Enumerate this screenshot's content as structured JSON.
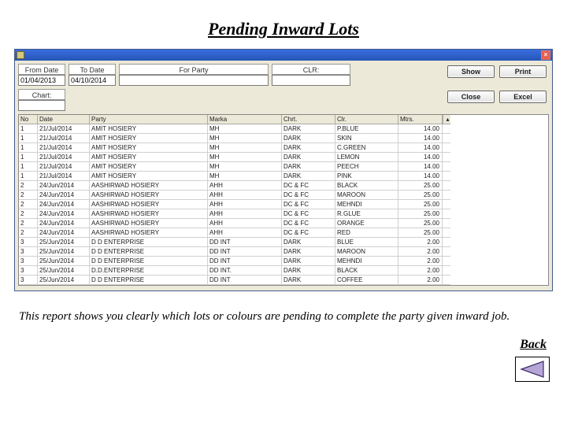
{
  "page": {
    "title": "Pending Inward Lots",
    "caption": "This report shows you clearly which lots or colours are pending to complete the party given inward job.",
    "back": "Back"
  },
  "filters": {
    "from_date_label": "From Date",
    "from_date_value": "01/04/2013",
    "to_date_label": "To Date",
    "to_date_value": "04/10/2014",
    "for_party_label": "For Party",
    "for_party_value": "",
    "clr_label": "CLR:",
    "clr_value": "",
    "chart_label": "Chart:",
    "chart_value": ""
  },
  "buttons": {
    "show": "Show",
    "print": "Print",
    "close": "Close",
    "excel": "Excel"
  },
  "grid": {
    "headers": [
      "No",
      "Date",
      "Party",
      "Marka",
      "Chrt.",
      "Clr.",
      "Mtrs."
    ],
    "rows": [
      {
        "no": "1",
        "date": "21/Jul/2014",
        "party": "AMIT HOSIERY",
        "marka": "MH",
        "chrt": "DARK",
        "clr": "P.BLUE",
        "mtrs": "14.00"
      },
      {
        "no": "1",
        "date": "21/Jul/2014",
        "party": "AMIT HOSIERY",
        "marka": "MH",
        "chrt": "DARK",
        "clr": "SKIN",
        "mtrs": "14.00"
      },
      {
        "no": "1",
        "date": "21/Jul/2014",
        "party": "AMIT HOSIERY",
        "marka": "MH",
        "chrt": "DARK",
        "clr": "C.GREEN",
        "mtrs": "14.00"
      },
      {
        "no": "1",
        "date": "21/Jul/2014",
        "party": "AMIT HOSIERY",
        "marka": "MH",
        "chrt": "DARK",
        "clr": "LEMON",
        "mtrs": "14.00"
      },
      {
        "no": "1",
        "date": "21/Jul/2014",
        "party": "AMIT HOSIERY",
        "marka": "MH",
        "chrt": "DARK",
        "clr": "PEECH",
        "mtrs": "14.00"
      },
      {
        "no": "1",
        "date": "21/Jul/2014",
        "party": "AMIT HOSIERY",
        "marka": "MH",
        "chrt": "DARK",
        "clr": "PINK",
        "mtrs": "14.00"
      },
      {
        "no": "2",
        "date": "24/Jun/2014",
        "party": "AASHIRWAD HOSIERY",
        "marka": "AHH",
        "chrt": "DC & FC",
        "clr": "BLACK",
        "mtrs": "25.00"
      },
      {
        "no": "2",
        "date": "24/Jun/2014",
        "party": "AASHIRWAD HOSIERY",
        "marka": "AHH",
        "chrt": "DC & FC",
        "clr": "MAROON",
        "mtrs": "25.00"
      },
      {
        "no": "2",
        "date": "24/Jun/2014",
        "party": "AASHIRWAD HOSIERY",
        "marka": "AHH",
        "chrt": "DC & FC",
        "clr": "MEHNDI",
        "mtrs": "25.00"
      },
      {
        "no": "2",
        "date": "24/Jun/2014",
        "party": "AASHIRWAD HOSIERY",
        "marka": "AHH",
        "chrt": "DC & FC",
        "clr": "R.GLUE",
        "mtrs": "25.00"
      },
      {
        "no": "2",
        "date": "24/Jun/2014",
        "party": "AASHIRWAD HOSIERY",
        "marka": "AHH",
        "chrt": "DC & FC",
        "clr": "ORANGE",
        "mtrs": "25.00"
      },
      {
        "no": "2",
        "date": "24/Jun/2014",
        "party": "AASHIRWAD HOSIERY",
        "marka": "AHH",
        "chrt": "DC & FC",
        "clr": "RED",
        "mtrs": "25.00"
      },
      {
        "no": "3",
        "date": "25/Jun/2014",
        "party": "D D ENTERPRISE",
        "marka": "DD INT",
        "chrt": "DARK",
        "clr": "BLUE",
        "mtrs": "2.00"
      },
      {
        "no": "3",
        "date": "25/Jun/2014",
        "party": "D D ENTERPRISE",
        "marka": "DD INT",
        "chrt": "DARK",
        "clr": "MAROON",
        "mtrs": "2.00"
      },
      {
        "no": "3",
        "date": "25/Jun/2014",
        "party": "D D ENTERPRISE",
        "marka": "DD INT",
        "chrt": "DARK",
        "clr": "MEHNDI",
        "mtrs": "2.00"
      },
      {
        "no": "3",
        "date": "25/Jun/2014",
        "party": "D.D.ENTERPRISE",
        "marka": "DD INT.",
        "chrt": "DARK",
        "clr": "BLACK",
        "mtrs": "2.00"
      },
      {
        "no": "3",
        "date": "25/Jun/2014",
        "party": "D D ENTERPRISE",
        "marka": "DD INT",
        "chrt": "DARK",
        "clr": "COFFEE",
        "mtrs": "2.00"
      }
    ]
  }
}
